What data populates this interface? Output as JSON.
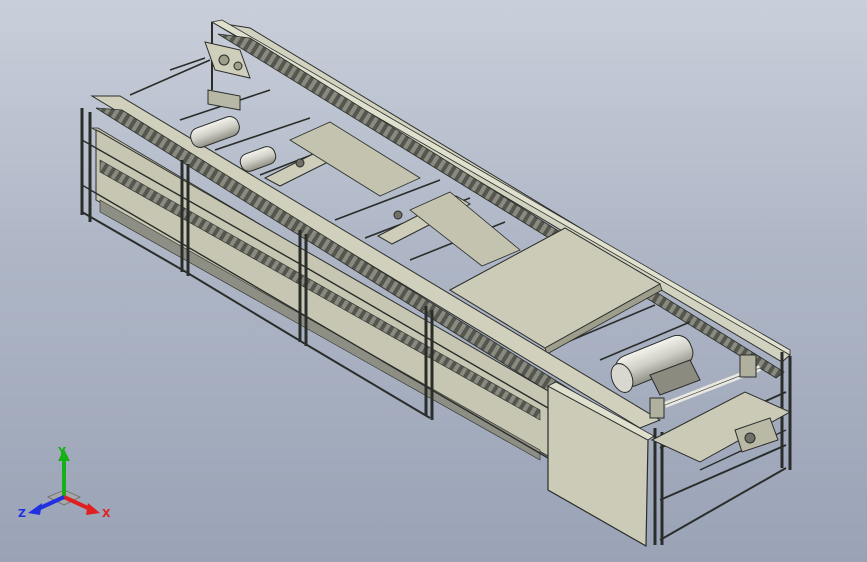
{
  "viewport": {
    "background_top": "#c9cfda",
    "background_bottom": "#9aa3b6"
  },
  "model": {
    "frame_color": "#2b2d2a",
    "panel_color": "#c9c9b6",
    "panel_shadow": "#9e9e8c",
    "panel_light": "#dcdccb",
    "chain_color": "#6f7068",
    "motor_color": "#e3e3dc"
  },
  "triad": {
    "x_label": "X",
    "y_label": "Y",
    "z_label": "Z",
    "x_color": "#e02020",
    "y_color": "#18b018",
    "z_color": "#2030e0"
  }
}
